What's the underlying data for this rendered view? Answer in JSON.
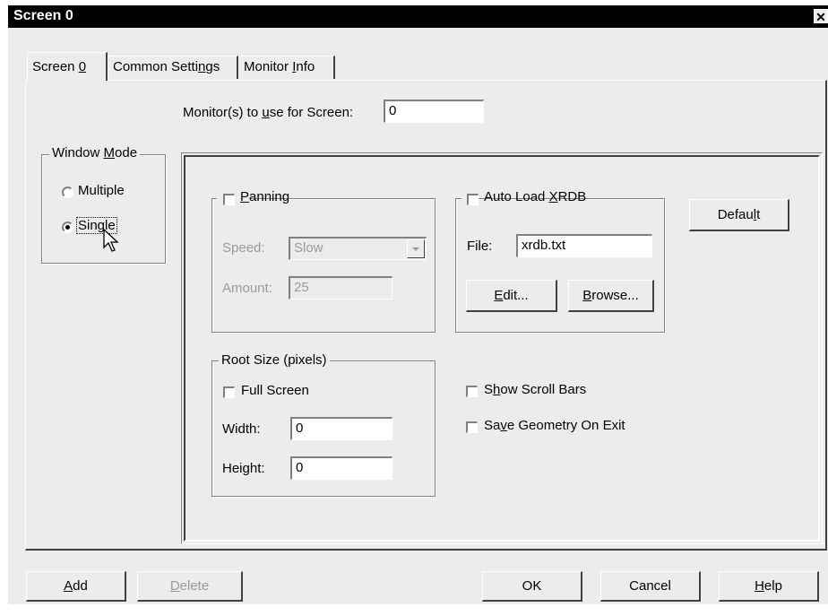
{
  "window": {
    "title": "Screen 0",
    "close_glyph": "✕"
  },
  "tabs": [
    {
      "label_pre": "Screen ",
      "label_u": "0",
      "label_post": ""
    },
    {
      "label_pre": "Common Setti",
      "label_u": "n",
      "label_post": "gs"
    },
    {
      "label_pre": "Monitor ",
      "label_u": "I",
      "label_post": "nfo"
    }
  ],
  "monitor": {
    "label_pre": "Monitor(s) to ",
    "label_u": "u",
    "label_post": "se for Screen:",
    "value": "0"
  },
  "window_mode": {
    "title_pre": "Window ",
    "title_u": "M",
    "title_post": "ode",
    "multiple": "Multiple",
    "single": "Single",
    "selected": "Single"
  },
  "panning": {
    "label_pre": "",
    "label_u": "P",
    "label_post": "anning",
    "checked": false,
    "speed_label": "Speed:",
    "speed_value": "Slow",
    "amount_label": "Amount:",
    "amount_value": "25"
  },
  "xrdb": {
    "label_pre": "Auto Load ",
    "label_u": "X",
    "label_post": "RDB",
    "checked": false,
    "file_label": "File:",
    "file_value": "xrdb.txt",
    "edit_pre": "",
    "edit_u": "E",
    "edit_post": "dit...",
    "browse_pre": "",
    "browse_u": "B",
    "browse_post": "rowse..."
  },
  "default_button": {
    "pre": "Defau",
    "u": "l",
    "post": "t"
  },
  "root_size": {
    "title": "Root Size (pixels)",
    "full_screen": "Full Screen",
    "full_screen_checked": false,
    "width_label": "Width:",
    "width_value": "0",
    "height_label": "Height:",
    "height_value": "0"
  },
  "options": {
    "scroll_pre": "S",
    "scroll_u": "h",
    "scroll_post": "ow Scroll Bars",
    "geometry_pre": "Sa",
    "geometry_u": "v",
    "geometry_post": "e Geometry On Exit"
  },
  "footer": {
    "add_u": "A",
    "add_post": "dd",
    "delete_u": "D",
    "delete_post": "elete",
    "ok": "OK",
    "cancel": "Cancel",
    "help_u": "H",
    "help_post": "elp"
  }
}
